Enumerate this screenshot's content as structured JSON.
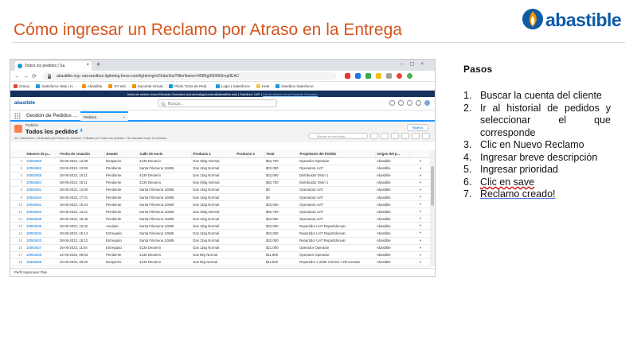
{
  "slide": {
    "title": "Cómo ingresar un Reclamo por Atraso en la Entrega",
    "logo_text": "abastible",
    "accent_color": "#d4541c",
    "brand_color": "#0d5aa7"
  },
  "browser": {
    "tab_title": "Todos los pedidos | Sa",
    "url": "abastible.org--uat.sandbox.lightning.force.com/lightning/o/Order/list?filterName=00B6g000000Imp0EAC",
    "bookmarks": [
      "Gmiao",
      "Salesforce Help | H...",
      "Abastible",
      "SV test",
      "Sucursal Virtual",
      "Piloto Toma de Pedi...",
      "Login | Salesforce",
      "Hete",
      "Sandbox Salesforce"
    ]
  },
  "salesforce": {
    "banner": "Inicio de sesión como Eduardo Gonzalez (eduardo@gonzalez@abastible.uat) | Sandbox: UAT |",
    "banner_link": "Cerrar sesión como Eduardo Gonzalez",
    "logo": "abastible",
    "search_placeholder": "Buscar...",
    "app_name": "Gestión de Pedidos ...",
    "nav_tab": "Pedidos",
    "object_label": "Pedidos",
    "list_title": "Todos los pedidos",
    "new_button": "Nuevo",
    "list_meta": "50+ elementos • Ordenado por Fecha de creación • Filtrado por Todos los pedidos • Se actualizó hace 24 minutos",
    "list_search_placeholder": "Buscar en esta lista...",
    "columns": [
      "",
      "Número de p...",
      "Fecha de creación",
      "Estado",
      "Calle de envío",
      "Producto 1",
      "Producto 2",
      "Total",
      "Propietario del Pedido",
      "Origen del p..."
    ],
    "rows": [
      [
        "4",
        "10063663",
        "29-06-2022, 12:08",
        "Despacho",
        "4139 Deuterio",
        "Gas 45kg Normal",
        "",
        "$62,700",
        "Operador Operador",
        "Abastible"
      ],
      [
        "5",
        "10063662",
        "29-06-2022, 10:59",
        "Pendiente",
        "Santa Filomena 12685",
        "Gas 11kg Normal",
        "",
        "$22,050",
        "Operadora UAT",
        "Abastible"
      ],
      [
        "6",
        "10063655",
        "28-06-2022, 18:11",
        "Pendiente",
        "4139 Deuterio",
        "Gas 11kg Normal",
        "",
        "$22,050",
        "Distribuidor Distri 1",
        "Abastible"
      ],
      [
        "7",
        "10063654",
        "28-06-2022, 18:11",
        "Pendiente",
        "4139 Deuterio",
        "Gas 45kg Normal",
        "",
        "$62,700",
        "Distribuidor Distri 1",
        "Abastible"
      ],
      [
        "8",
        "10063651",
        "28-06-2022, 14:00",
        "Pendiente",
        "Santa Filomena 12685",
        "Gas 11kg Normal",
        "",
        "$0",
        "Operadora UAT",
        "Abastible"
      ],
      [
        "9",
        "10063644",
        "28-06-2022, 17:01",
        "Pendiente",
        "Santa Filomena 12685",
        "Gas 11kg Normal",
        "",
        "$0",
        "Operadora UAT",
        "Abastible"
      ],
      [
        "10",
        "10063641",
        "28-06-2022, 16:24",
        "Pendiente",
        "Santa Filomena 12685",
        "Gas 11kg Normal",
        "",
        "$22,050",
        "Operadora UAT",
        "Abastible"
      ],
      [
        "11",
        "10063640",
        "28-06-2022, 16:21",
        "Pendiente",
        "Santa Filomena 12685",
        "Gas 45kg Normal",
        "",
        "$62,700",
        "Operadora UAT",
        "Abastible"
      ],
      [
        "12",
        "10063639",
        "28-06-2022, 15:46",
        "Pendiente",
        "Santa Filomena 12685",
        "Gas 11kg Normal",
        "",
        "$22,050",
        "Operadora UAT",
        "Abastible"
      ],
      [
        "13",
        "10063635",
        "28-06-2022, 15:32",
        "Anulado",
        "Santa Filomena 12685",
        "Gas 11kg Normal",
        "",
        "$22,050",
        "Repartidor UAT Repartidonuat",
        "Abastible"
      ],
      [
        "14",
        "10063634",
        "28-06-2022, 15:14",
        "Entregado",
        "Santa Filomena 12685",
        "Gas 11kg Normal",
        "",
        "$22,050",
        "Repartidor UAT Repartidonuat",
        "Abastible"
      ],
      [
        "15",
        "10063633",
        "28-06-2022, 15:12",
        "Entregado",
        "Santa Filomena 12685",
        "Gas 11kg Normal",
        "",
        "$22,050",
        "Repartidor UAT Repartidonuat",
        "Abastible"
      ],
      [
        "16",
        "10063627",
        "26-06-2022, 11:04",
        "Entregado",
        "4139 Deuterio",
        "Gas 11kg Normal",
        "",
        "$21,000",
        "Operador Operador",
        "Abastible"
      ],
      [
        "17",
        "10063626",
        "22-06-2022, 09:53",
        "Pendiente",
        "4139 Deuterio",
        "Gas 5kg Normal",
        "",
        "$11,800",
        "Operador Operador",
        "Abastible"
      ],
      [
        "18",
        "10063625",
        "22-06-2022, 09:20",
        "Despacho",
        "4139 Deuterio",
        "Gas 5kg Normal",
        "",
        "$11,800",
        "Repartidor 1 2535 Camino A Rinconada",
        "Abastible"
      ]
    ],
    "utility_bar": "Perfil Supervisor Plus"
  },
  "steps": {
    "title": "Pasos",
    "items": [
      "Buscar la cuenta del cliente",
      "Ir al historial de pedidos y seleccionar el que corresponde",
      "Clic en Nuevo Reclamo",
      "Ingresar breve descripción",
      "Ingresar prioridad",
      "Clic en save",
      "Reclamo creado!"
    ]
  }
}
